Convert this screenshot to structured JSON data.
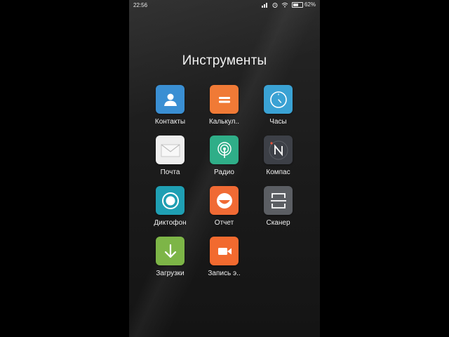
{
  "status_bar": {
    "time": "22:56",
    "battery_text": "62%",
    "battery_level": 0.62,
    "icons": [
      "signal-icon",
      "alarm-icon",
      "wifi-icon",
      "battery-icon"
    ]
  },
  "folder": {
    "title": "Инструменты"
  },
  "apps": [
    {
      "label": "Контакты",
      "icon": "contacts-icon",
      "color": "#3a8fd3"
    },
    {
      "label": "Калькул..",
      "icon": "calculator-icon",
      "color": "#f07a36"
    },
    {
      "label": "Часы",
      "icon": "clock-icon",
      "color": "#3aa2d4"
    },
    {
      "label": "Почта",
      "icon": "mail-icon",
      "color": "#eeeeee"
    },
    {
      "label": "Радио",
      "icon": "radio-icon",
      "color": "#2fae88"
    },
    {
      "label": "Компас",
      "icon": "compass-icon",
      "color": "#3d4047"
    },
    {
      "label": "Диктофон",
      "icon": "recorder-icon",
      "color": "#1f9fb3"
    },
    {
      "label": "Отчет",
      "icon": "report-icon",
      "color": "#f06a34"
    },
    {
      "label": "Сканер",
      "icon": "scanner-icon",
      "color": "#5b5e63"
    },
    {
      "label": "Загрузки",
      "icon": "downloads-icon",
      "color": "#7db547"
    },
    {
      "label": "Запись э..",
      "icon": "screen-recorder-icon",
      "color": "#f26a2f"
    }
  ]
}
